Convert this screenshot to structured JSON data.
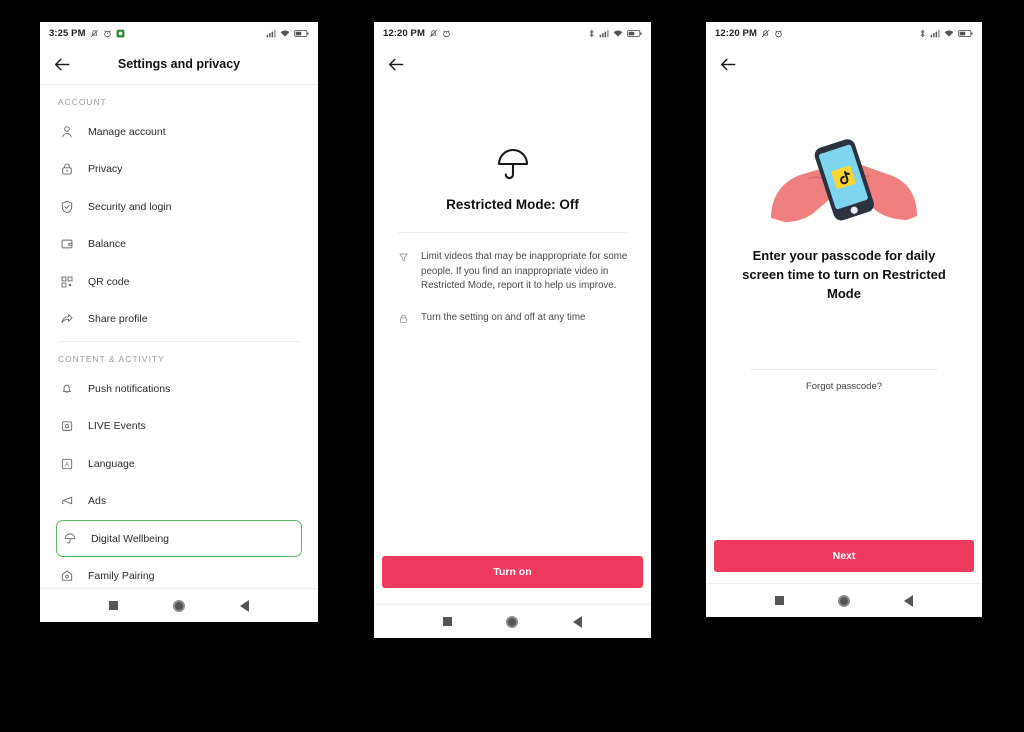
{
  "theme": {
    "accent_pink": "#EE3A5C",
    "highlight_green": "#5CB85C",
    "background": "#000000",
    "screen_bg": "#FFFFFF"
  },
  "phone1": {
    "status_bar": {
      "time": "3:25 PM",
      "left_icons": [
        "bell-off-icon",
        "alarm-icon",
        "app-badge-icon"
      ],
      "right_icons": [
        "signal-icon",
        "wifi-icon",
        "battery-icon"
      ]
    },
    "header": {
      "back": "back-arrow",
      "title": "Settings and privacy"
    },
    "sections": [
      {
        "label": "ACCOUNT",
        "items": [
          {
            "icon": "person-icon",
            "label": "Manage account"
          },
          {
            "icon": "lock-icon",
            "label": "Privacy"
          },
          {
            "icon": "shield-icon",
            "label": "Security and login"
          },
          {
            "icon": "wallet-icon",
            "label": "Balance"
          },
          {
            "icon": "qr-icon",
            "label": "QR code"
          },
          {
            "icon": "share-icon",
            "label": "Share profile"
          }
        ]
      },
      {
        "label": "CONTENT & ACTIVITY",
        "items": [
          {
            "icon": "bell-icon",
            "label": "Push notifications"
          },
          {
            "icon": "live-icon",
            "label": "LIVE Events"
          },
          {
            "icon": "language-icon",
            "label": "Language"
          },
          {
            "icon": "megaphone-icon",
            "label": "Ads"
          },
          {
            "icon": "umbrella-icon",
            "label": "Digital Wellbeing",
            "highlighted": true
          },
          {
            "icon": "house-icon",
            "label": "Family Pairing"
          }
        ]
      }
    ],
    "nav": [
      "square-button",
      "home-button",
      "back-button"
    ]
  },
  "phone2": {
    "status_bar": {
      "time": "12:20 PM",
      "left_icons": [
        "bell-off-icon",
        "alarm-icon"
      ],
      "right_icons": [
        "bluetooth-icon",
        "signal-icon",
        "wifi-icon",
        "battery-icon"
      ]
    },
    "header": {
      "back": "back-arrow",
      "title": ""
    },
    "hero_icon": "umbrella-icon",
    "title": "Restricted Mode: Off",
    "bullets": [
      {
        "icon": "filter-icon",
        "text": "Limit videos that may be inappropriate for some people. If you find an inappropriate video in Restricted Mode, report it to help us improve."
      },
      {
        "icon": "lock-icon",
        "text": "Turn the setting on and off at any time"
      }
    ],
    "cta_label": "Turn on",
    "nav": [
      "square-button",
      "home-button",
      "back-button"
    ]
  },
  "phone3": {
    "status_bar": {
      "time": "12:20 PM",
      "left_icons": [
        "bell-off-icon",
        "alarm-icon"
      ],
      "right_icons": [
        "bluetooth-icon",
        "signal-icon",
        "wifi-icon",
        "battery-icon"
      ]
    },
    "header": {
      "back": "back-arrow",
      "title": ""
    },
    "illustration": "hands-holding-phone-illustration",
    "title": "Enter your passcode for daily screen time to turn on Restricted Mode",
    "passcode_value": "",
    "passcode_placeholder": "",
    "forgot_label": "Forgot passcode?",
    "cta_label": "Next",
    "nav": [
      "square-button",
      "home-button",
      "back-button"
    ]
  }
}
